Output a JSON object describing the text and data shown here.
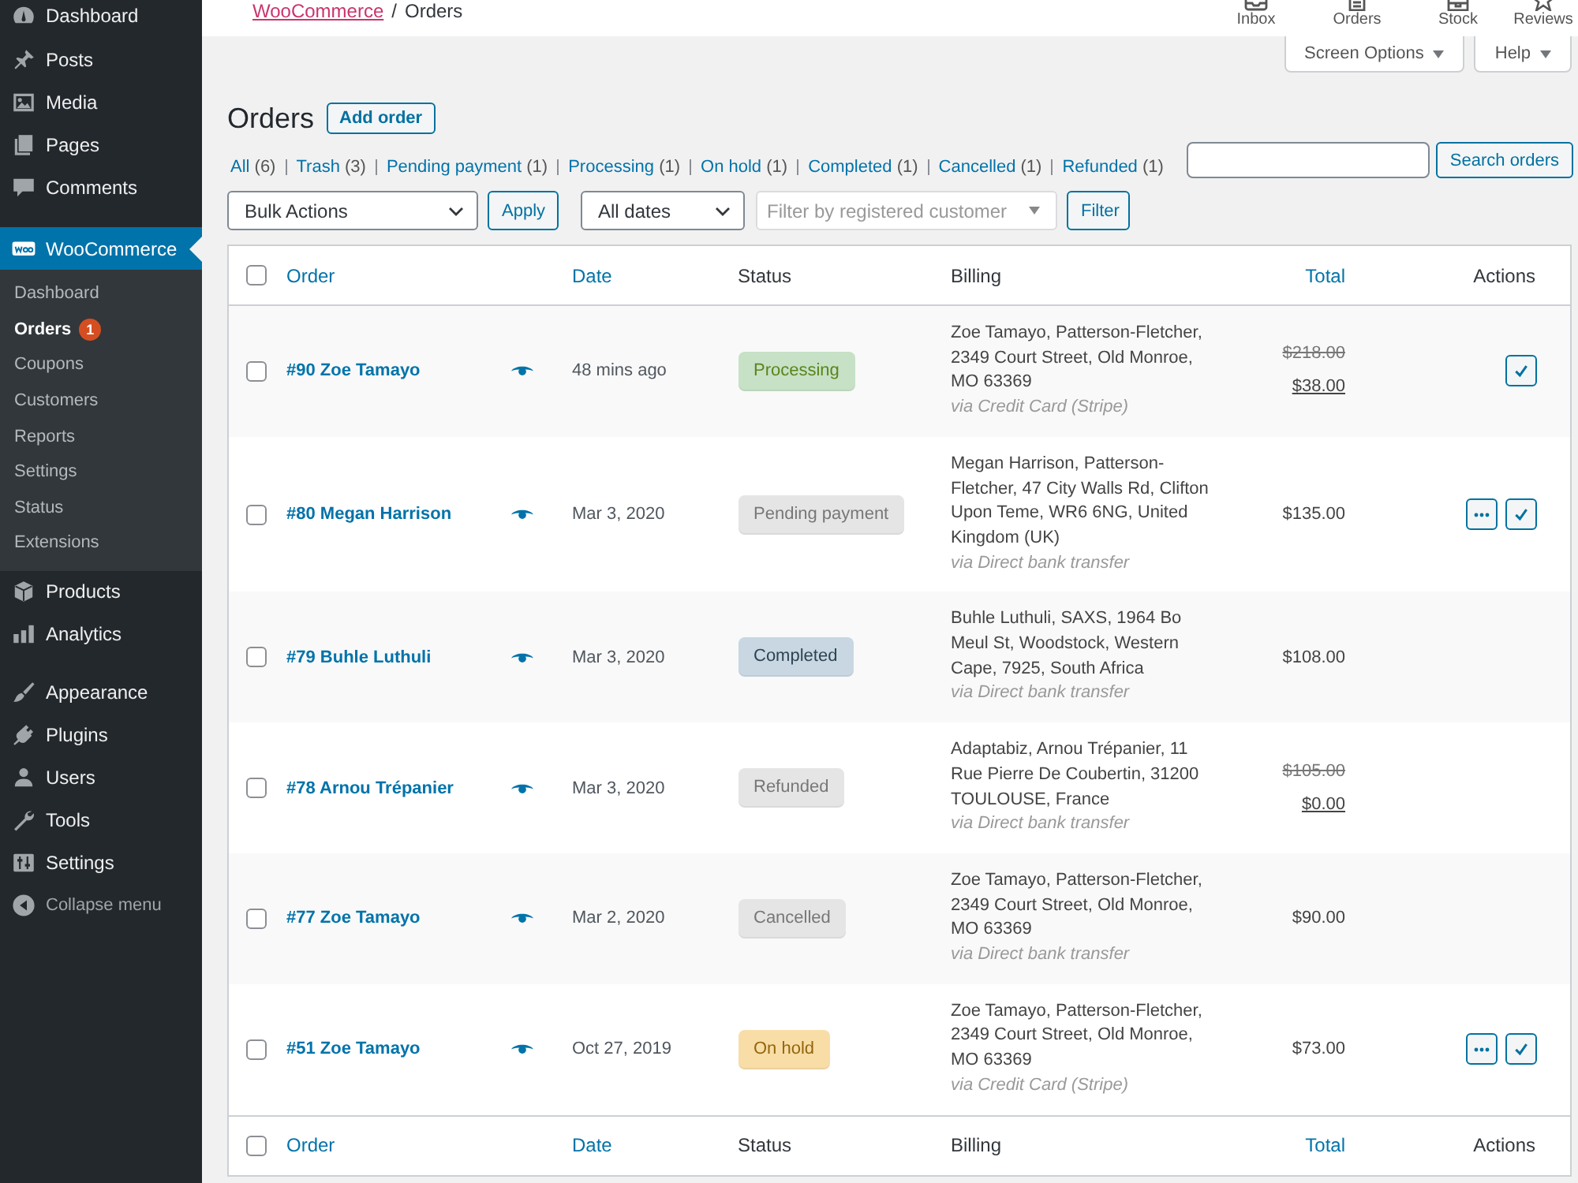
{
  "top_bar": {
    "breadcrumb": {
      "parent": "WooCommerce",
      "separator": "/",
      "current": "Orders"
    },
    "items": [
      {
        "label": "Inbox"
      },
      {
        "label": "Orders"
      },
      {
        "label": "Stock"
      },
      {
        "label": "Reviews"
      }
    ]
  },
  "sidebar": {
    "groups": [
      {
        "items": [
          {
            "label": "Dashboard",
            "selected": false
          }
        ]
      },
      {
        "items": [
          {
            "label": "Posts",
            "selected": false
          },
          {
            "label": "Media",
            "selected": false
          },
          {
            "label": "Pages",
            "selected": false
          },
          {
            "label": "Comments",
            "selected": false
          }
        ]
      },
      {
        "items": [
          {
            "label": "WooCommerce",
            "selected": true,
            "children": [
              {
                "label": "Dashboard",
                "selected": false
              },
              {
                "label": "Orders",
                "selected": true,
                "badge": "1"
              },
              {
                "label": "Coupons",
                "selected": false
              },
              {
                "label": "Customers",
                "selected": false
              },
              {
                "label": "Reports",
                "selected": false
              },
              {
                "label": "Settings",
                "selected": false
              },
              {
                "label": "Status",
                "selected": false
              },
              {
                "label": "Extensions",
                "selected": false
              }
            ]
          },
          {
            "label": "Products",
            "selected": false
          },
          {
            "label": "Analytics",
            "selected": false
          }
        ]
      },
      {
        "items": [
          {
            "label": "Appearance",
            "selected": false
          },
          {
            "label": "Plugins",
            "selected": false
          },
          {
            "label": "Users",
            "selected": false
          },
          {
            "label": "Tools",
            "selected": false
          },
          {
            "label": "Settings",
            "selected": false
          }
        ]
      }
    ],
    "collapse": "Collapse menu"
  },
  "screen_meta": {
    "tabs": [
      {
        "label": "Screen Options"
      },
      {
        "label": "Help"
      }
    ]
  },
  "page": {
    "title": "Orders",
    "add_button": "Add order"
  },
  "status_filters": [
    {
      "label": "All",
      "count": "(6)"
    },
    {
      "label": "Trash",
      "count": "(3)"
    },
    {
      "label": "Pending payment",
      "count": "(1)"
    },
    {
      "label": "Processing",
      "count": "(1)"
    },
    {
      "label": "On hold",
      "count": "(1)"
    },
    {
      "label": "Completed",
      "count": "(1)"
    },
    {
      "label": "Cancelled",
      "count": "(1)"
    },
    {
      "label": "Refunded",
      "count": "(1)"
    }
  ],
  "search": {
    "button": "Search orders"
  },
  "tablenav": {
    "bulk_action": "Bulk Actions",
    "apply": "Apply",
    "date_filter": "All dates",
    "customer_filter": {
      "placeholder": "Filter by registered customer"
    },
    "filter": "Filter"
  },
  "table": {
    "header_checked": false,
    "columns": [
      {
        "label": "Order",
        "sortable": true
      },
      {
        "label": "Date",
        "sortable": true
      },
      {
        "label": "Status",
        "sortable": false
      },
      {
        "label": "Billing",
        "sortable": false
      },
      {
        "label": "Total",
        "sortable": true
      },
      {
        "label": "Actions",
        "sortable": false
      }
    ],
    "rows": [
      {
        "checked": false,
        "order": "#90 Zoe Tamayo",
        "date": "48 mins ago",
        "status": {
          "label": "Processing",
          "kind": "processing"
        },
        "billing": "Zoe Tamayo, Patterson-Fletcher, 2349 Court Street, Old Monroe, MO 63369",
        "payment": "via Credit Card (Stripe)",
        "original_total": "$218.00",
        "total": "$38.00",
        "actions": [
          {
            "kind": "complete"
          }
        ]
      },
      {
        "checked": false,
        "order": "#80 Megan Harrison",
        "date": "Mar 3, 2020",
        "status": {
          "label": "Pending payment",
          "kind": "pending"
        },
        "billing": "Megan Harrison, Patterson-Fletcher, 47 City Walls Rd, Clifton Upon Teme, WR6 6NG, United Kingdom (UK)",
        "payment": "via Direct bank transfer",
        "total": "$135.00",
        "actions": [
          {
            "kind": "processing"
          },
          {
            "kind": "complete"
          }
        ]
      },
      {
        "checked": false,
        "order": "#79 Buhle Luthuli",
        "date": "Mar 3, 2020",
        "status": {
          "label": "Completed",
          "kind": "completed"
        },
        "billing": "Buhle Luthuli, SAXS, 1964 Bo Meul St, Woodstock, Western Cape, 7925, South Africa",
        "payment": "via Direct bank transfer",
        "total": "$108.00"
      },
      {
        "checked": false,
        "order": "#78 Arnou Trépanier",
        "date": "Mar 3, 2020",
        "status": {
          "label": "Refunded",
          "kind": "refunded"
        },
        "billing": "Adaptabiz, Arnou Trépanier, 11 Rue Pierre De Coubertin, 31200 TOULOUSE, France",
        "payment": "via Direct bank transfer",
        "original_total": "$105.00",
        "total": "$0.00"
      },
      {
        "checked": false,
        "order": "#77 Zoe Tamayo",
        "date": "Mar 2, 2020",
        "status": {
          "label": "Cancelled",
          "kind": "cancelled"
        },
        "billing": "Zoe Tamayo, Patterson-Fletcher, 2349 Court Street, Old Monroe, MO 63369",
        "payment": "via Direct bank transfer",
        "total": "$90.00"
      },
      {
        "checked": false,
        "order": "#51 Zoe Tamayo",
        "date": "Oct 27, 2019",
        "status": {
          "label": "On hold",
          "kind": "on-hold"
        },
        "billing": "Zoe Tamayo, Patterson-Fletcher, 2349 Court Street, Old Monroe, MO 63369",
        "payment": "via Credit Card (Stripe)",
        "total": "$73.00",
        "actions": [
          {
            "kind": "processing"
          },
          {
            "kind": "complete"
          }
        ]
      }
    ],
    "footer_checked": false,
    "footer_columns": [
      {
        "label": "Order",
        "sortable": true
      },
      {
        "label": "Date",
        "sortable": true
      },
      {
        "label": "Status",
        "sortable": false
      },
      {
        "label": "Billing",
        "sortable": false
      },
      {
        "label": "Total",
        "sortable": true
      },
      {
        "label": "Actions",
        "sortable": false
      }
    ]
  }
}
